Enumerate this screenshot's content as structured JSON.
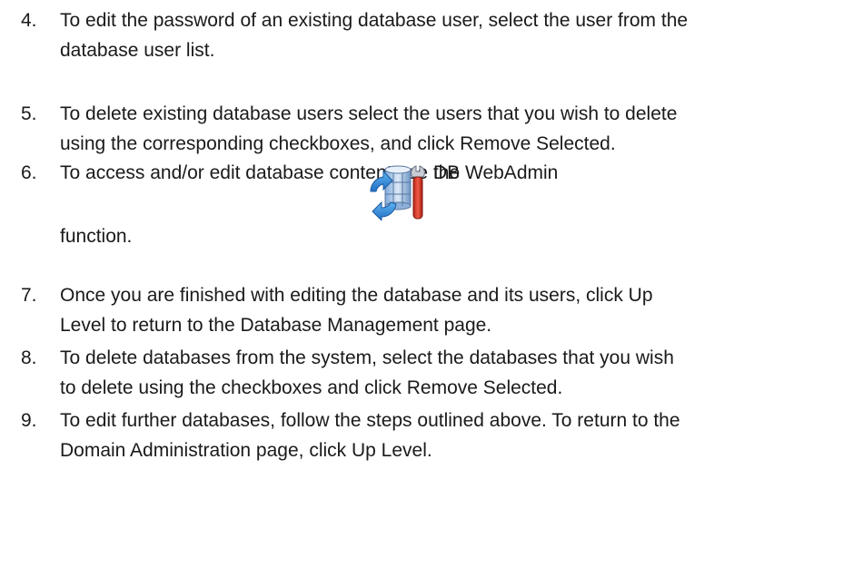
{
  "steps": [
    {
      "number": "4.",
      "lines": [
        "To edit the password of an existing database user, select the user from the",
        "database user list."
      ]
    },
    {
      "number": "5.",
      "lines": [
        "To delete existing database users select the users that you wish to delete",
        "using the corresponding checkboxes, and click Remove Selected."
      ]
    },
    {
      "number": "6.",
      "before_icon": "To access and/or edit database content use the",
      "icon": "db-webadmin-icon",
      "after_icon": "DB WebAdmin",
      "continuation": "function."
    },
    {
      "number": "7.",
      "lines": [
        "Once you are finished with editing the database and its users, click Up",
        "Level to return to the Database Management page."
      ]
    },
    {
      "number": "8.",
      "lines": [
        "To delete databases from the system, select the databases that you wish",
        "to delete using the checkboxes and click Remove Selected."
      ]
    },
    {
      "number": "9.",
      "lines": [
        "To edit further databases, follow the steps outlined above. To return to the",
        "Domain Administration page, click Up Level."
      ]
    }
  ],
  "colors": {
    "text": "#1a1a1a",
    "icon_blue": "#3a86d8",
    "icon_red": "#d63a2a"
  }
}
